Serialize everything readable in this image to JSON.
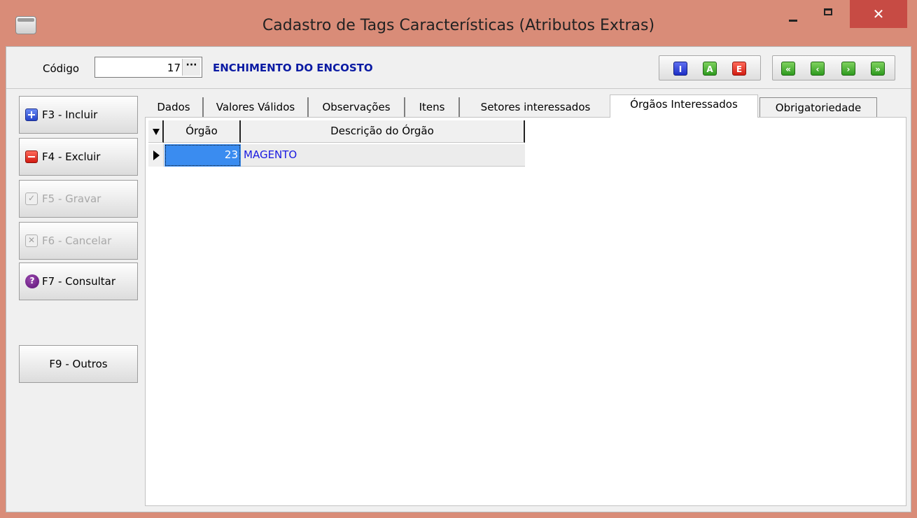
{
  "window": {
    "title": "Cadastro de Tags Características (Atributos Extras)",
    "close_glyph": "✕"
  },
  "header": {
    "code_label": "Código",
    "code_value": "17",
    "lookup_button": "···",
    "description": "ENCHIMENTO DO ENCOSTO",
    "mode_buttons": [
      "I",
      "A",
      "E"
    ],
    "nav_buttons": [
      "«",
      "‹",
      "›",
      "»"
    ]
  },
  "sidebar": {
    "buttons": [
      {
        "label": "F3 - Incluir",
        "icon": "plus-icon",
        "enabled": true
      },
      {
        "label": "F4 - Excluir",
        "icon": "minus-icon",
        "enabled": true
      },
      {
        "label": "F5 - Gravar",
        "icon": "check-icon",
        "enabled": false
      },
      {
        "label": "F6 - Cancelar",
        "icon": "x-box-icon",
        "enabled": false
      },
      {
        "label": "F7 - Consultar",
        "icon": "question-icon",
        "enabled": true
      },
      {
        "label": "F9 - Outros",
        "icon": null,
        "enabled": true
      }
    ],
    "question_glyph": "?",
    "check_glyph": "✓",
    "x_glyph": "✕"
  },
  "tabs": [
    {
      "label": "Dados",
      "active": false
    },
    {
      "label": "Valores Válidos",
      "active": false
    },
    {
      "label": "Observações",
      "active": false
    },
    {
      "label": "Itens",
      "active": false
    },
    {
      "label": "Setores interessados",
      "active": false
    },
    {
      "label": "Órgãos Interessados",
      "active": true
    },
    {
      "label": "Obrigatoriedade",
      "active": false
    }
  ],
  "grid": {
    "columns": [
      "Órgão",
      "Descrição do Órgão"
    ],
    "rows": [
      {
        "orgao": "23",
        "descricao": "MAGENTO"
      }
    ]
  },
  "colors": {
    "window_frame": "#d98c78",
    "close_button": "#c74b44",
    "description_text": "#0a1aa3",
    "selected_cell": "#3a8cf0",
    "grid_text": "#1a1ae0"
  }
}
